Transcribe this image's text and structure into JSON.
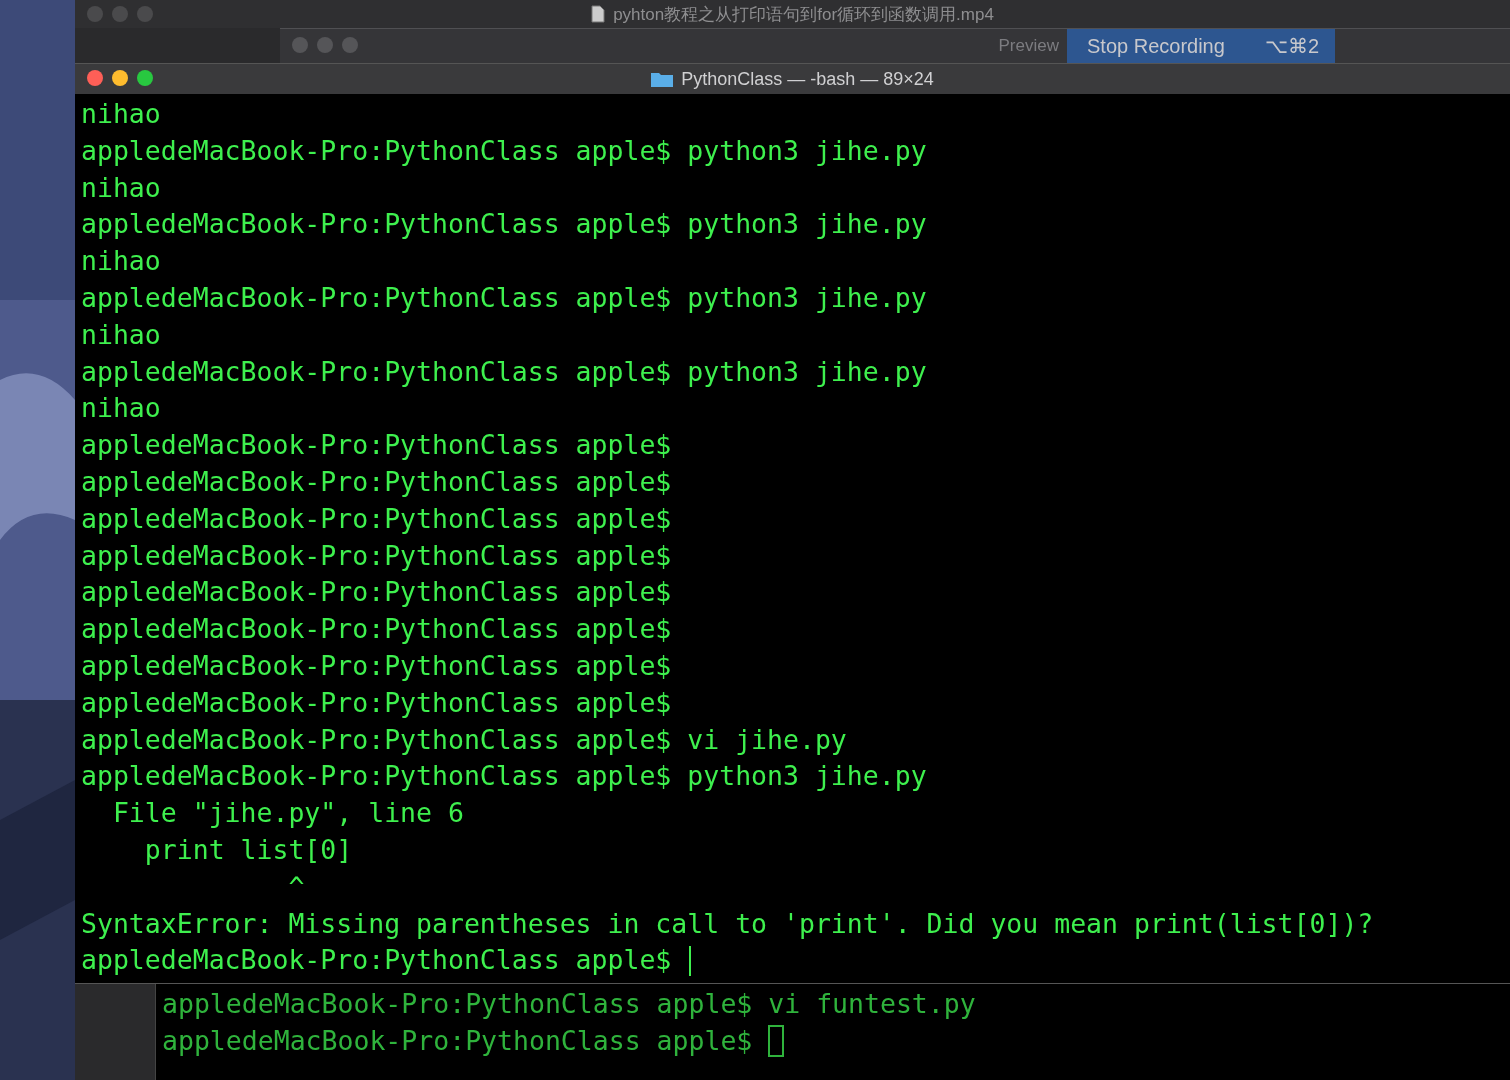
{
  "player": {
    "title": "pyhton教程之从打印语句到for循环到函数调用.mp4"
  },
  "back_window": {
    "title": "Preview",
    "menu_item": {
      "label": "Stop Recording",
      "shortcut": "⌥⌘2",
      "selected": true
    }
  },
  "terminal": {
    "title": "PythonClass — -bash — 89×24",
    "lines": [
      {
        "text": "nihao"
      },
      {
        "text": "appledeMacBook-Pro:PythonClass apple$ python3 jihe.py"
      },
      {
        "text": "nihao"
      },
      {
        "text": "appledeMacBook-Pro:PythonClass apple$ python3 jihe.py"
      },
      {
        "text": "nihao"
      },
      {
        "text": "appledeMacBook-Pro:PythonClass apple$ python3 jihe.py"
      },
      {
        "text": "nihao"
      },
      {
        "text": "appledeMacBook-Pro:PythonClass apple$ python3 jihe.py"
      },
      {
        "text": "nihao"
      },
      {
        "text": "appledeMacBook-Pro:PythonClass apple$"
      },
      {
        "text": "appledeMacBook-Pro:PythonClass apple$"
      },
      {
        "text": "appledeMacBook-Pro:PythonClass apple$"
      },
      {
        "text": "appledeMacBook-Pro:PythonClass apple$"
      },
      {
        "text": "appledeMacBook-Pro:PythonClass apple$"
      },
      {
        "text": "appledeMacBook-Pro:PythonClass apple$"
      },
      {
        "text": "appledeMacBook-Pro:PythonClass apple$"
      },
      {
        "text": "appledeMacBook-Pro:PythonClass apple$"
      },
      {
        "text": "appledeMacBook-Pro:PythonClass apple$ vi jihe.py"
      },
      {
        "text": "appledeMacBook-Pro:PythonClass apple$ python3 jihe.py"
      },
      {
        "text": "  File \"jihe.py\", line 6"
      },
      {
        "text": "    print list[0]"
      },
      {
        "text": "             ^"
      },
      {
        "text": "SyntaxError: Missing parentheses in call to 'print'. Did you mean print(list[0])?"
      },
      {
        "text": "appledeMacBook-Pro:PythonClass apple$ ",
        "cursor": true
      }
    ]
  },
  "back_terminal": {
    "lines": [
      {
        "text": "appledeMacBook-Pro:PythonClass apple$ vi funtest.py"
      },
      {
        "text": "appledeMacBook-Pro:PythonClass apple$ ",
        "cursor": true
      }
    ]
  }
}
